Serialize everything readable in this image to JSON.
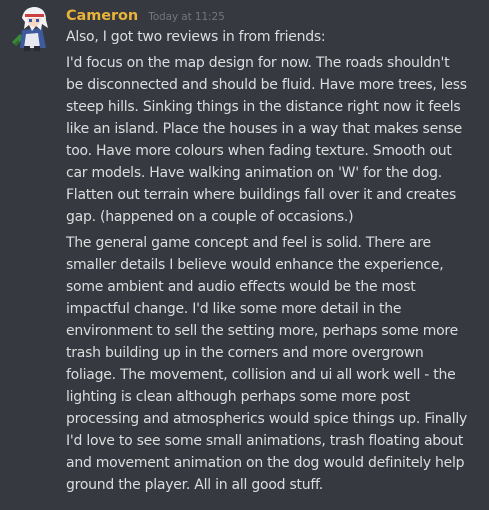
{
  "message": {
    "username": "Cameron",
    "username_color": "#e9b33a",
    "timestamp": "Today at 11:25",
    "avatar_icon": "anime-character-avatar-icon",
    "intro": "Also, I got two reviews in from friends:",
    "review_1_lines": [
      "I'd focus on the map design for now. The roads shouldn't",
      "be disconnected and should be fluid. Have more trees, less",
      "steep hills. Sinking things in the distance right now it feels",
      "like an island. Place the houses in a way that makes sense",
      "too. Have more colours when fading texture. Smooth out",
      "car models. Have walking animation on 'W' for the dog.",
      "Flatten out terrain where buildings fall over it and creates",
      "gap. (happened on a couple of occasions.)"
    ],
    "review_2_lines": [
      "The general game concept and feel is solid. There are",
      "smaller details I believe would enhance the experience,",
      "some ambient and audio effects would be the most",
      "impactful change. I'd like some more detail in the",
      "environment to sell the setting more, perhaps some more",
      "trash building up in the corners and more overgrown",
      "foliage. The movement, collision and ui all work well - the",
      "lighting is clean although perhaps some more post",
      "processing and atmospherics would spice things up. Finally",
      "I'd love to see some small animations, trash floating about",
      "and movement animation on the dog would definitely help",
      "ground the player. All in all good stuff."
    ]
  },
  "colors": {
    "background": "#36393f",
    "text": "#dcddde",
    "timestamp": "#72767d"
  }
}
